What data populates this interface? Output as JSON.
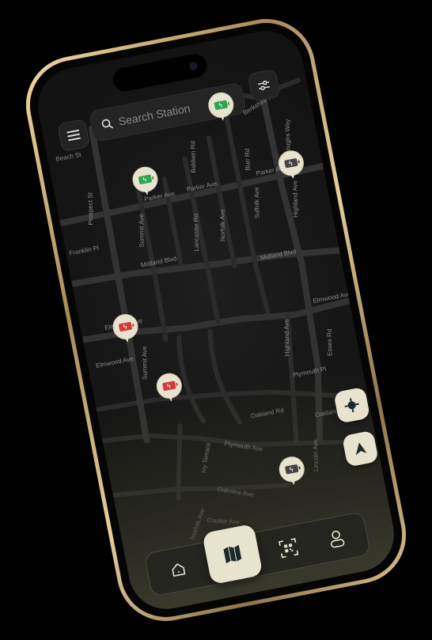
{
  "search": {
    "placeholder": "Search Station"
  },
  "map": {
    "streets": [
      "Parker Ave.",
      "Parker Ave.",
      "Parker Ave.",
      "Prospect St",
      "Summit Ave",
      "Baldwin Rd",
      "Lancaster Rd",
      "Norfolk Ave",
      "Suffolk Ave",
      "Burr Rd",
      "Berkshire Rd",
      "Burroughs Way",
      "Highland Ave",
      "Beach St",
      "Franklin Pl",
      "Midland Blvd",
      "Midland Blvd",
      "Elmwood Ave",
      "Elmwood Ave",
      "Elmwood Ave",
      "Summit Ave",
      "Highland Ave",
      "Essex Rd",
      "Plymouth Pl",
      "Oakland Rd",
      "Oakland Rd",
      "Ivy Terrace",
      "Plymouth Ave",
      "Oakview Ave",
      "Norfolk Ave",
      "Coulter Ave",
      "Lincoln Ave"
    ],
    "stations": [
      {
        "status": "available",
        "color": "#2ea44f"
      },
      {
        "status": "available",
        "color": "#2ea44f"
      },
      {
        "status": "in-use",
        "color": "#444444"
      },
      {
        "status": "unavailable",
        "color": "#d23a3a"
      },
      {
        "status": "unavailable",
        "color": "#d23a3a"
      },
      {
        "status": "in-use",
        "color": "#444444"
      }
    ]
  },
  "tabs": [
    {
      "name": "home-icon",
      "active": false
    },
    {
      "name": "map-icon",
      "active": true
    },
    {
      "name": "qr-scan-icon",
      "active": false
    },
    {
      "name": "profile-icon",
      "active": false
    }
  ],
  "colors": {
    "accent": "#e8e3cf",
    "available": "#2ea44f",
    "unavailable": "#d23a3a",
    "background": "#141414"
  }
}
